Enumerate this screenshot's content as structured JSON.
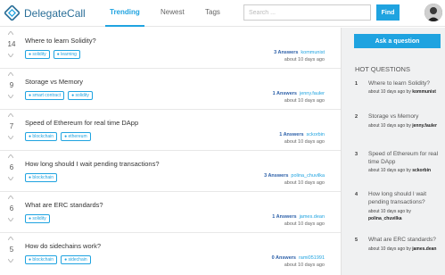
{
  "header": {
    "logo_text": "DelegateCall",
    "tabs": [
      "Trending",
      "Newest",
      "Tags"
    ],
    "search_placeholder": "Search ...",
    "find_label": "Find"
  },
  "questions": [
    {
      "votes": "14",
      "title": "Where to learn Solidity?",
      "tags": [
        "solidity",
        "learning"
      ],
      "answers": "3 Answers",
      "user": "kommunist",
      "ago": "about 10 days ago"
    },
    {
      "votes": "9",
      "title": "Storage vs Memory",
      "tags": [
        "smart contract",
        "solidity"
      ],
      "answers": "1 Answers",
      "user": "jenny.fauler",
      "ago": "about 10 days ago"
    },
    {
      "votes": "7",
      "title": "Speed of Ethereum for real time DApp",
      "tags": [
        "blockchain",
        "ethereum"
      ],
      "answers": "1 Answers",
      "user": "sckorbin",
      "ago": "about 10 days ago"
    },
    {
      "votes": "6",
      "title": "How long should I wait pending transactions?",
      "tags": [
        "blockchain"
      ],
      "answers": "3 Answers",
      "user": "polina_chuvilka",
      "ago": "about 10 days ago"
    },
    {
      "votes": "6",
      "title": "What are ERC standards?",
      "tags": [
        "solidity"
      ],
      "answers": "1 Answers",
      "user": "james.dean",
      "ago": "about 10 days ago"
    },
    {
      "votes": "5",
      "title": "How do sidechains work?",
      "tags": [
        "blockchain",
        "sidechain"
      ],
      "answers": "0 Answers",
      "user": "rami051991",
      "ago": "about 10 days ago"
    }
  ],
  "sidebar": {
    "ask_label": "Ask a question",
    "hot_title": "HOT QUESTIONS",
    "hot": [
      {
        "num": "1",
        "q": "Where to learn Solidity?",
        "meta": "about 10 days ago by",
        "user": "kommunist"
      },
      {
        "num": "2",
        "q": "Storage vs Memory",
        "meta": "about 10 days ago by",
        "user": "jenny.fauler"
      },
      {
        "num": "3",
        "q": "Speed of Ethereum for real time DApp",
        "meta": "about 10 days ago by",
        "user": "sckorbin"
      },
      {
        "num": "4",
        "q": "How long should I wait pending transactions?",
        "meta": "about 10 days ago by",
        "user": "polina_chuvilka"
      },
      {
        "num": "5",
        "q": "What are ERC standards?",
        "meta": "about 10 days ago by",
        "user": "james.dean"
      }
    ]
  },
  "colors": {
    "accent": "#1fa3e0",
    "brand": "#2b6f98"
  }
}
